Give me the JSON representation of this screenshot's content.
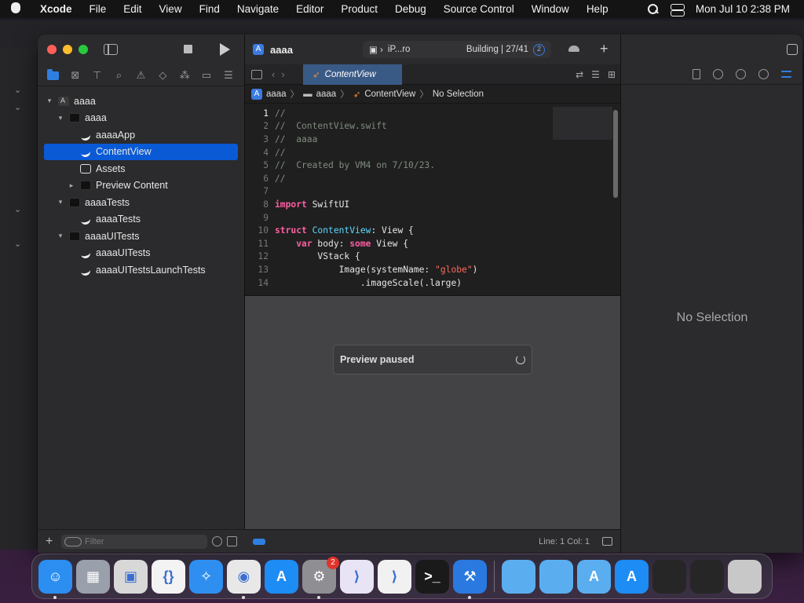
{
  "menubar": {
    "app_name": "Xcode",
    "items": [
      "File",
      "Edit",
      "View",
      "Find",
      "Navigate",
      "Editor",
      "Product",
      "Debug",
      "Source Control",
      "Window",
      "Help"
    ],
    "clock": "Mon Jul 10  2:38 PM"
  },
  "toolbar": {
    "project_name": "aaaa",
    "device": "iP...ro",
    "status": "Building | 27/41",
    "issue_count": "2"
  },
  "editor": {
    "active_tab": "ContentView",
    "breadcrumb": [
      "aaaa",
      "aaaa",
      "ContentView",
      "No Selection"
    ],
    "code_lines": [
      {
        "n": "1",
        "parts": [
          {
            "c": "cm",
            "t": "//"
          }
        ]
      },
      {
        "n": "2",
        "parts": [
          {
            "c": "cm",
            "t": "//  ContentView.swift"
          }
        ]
      },
      {
        "n": "3",
        "parts": [
          {
            "c": "cm",
            "t": "//  aaaa"
          }
        ]
      },
      {
        "n": "4",
        "parts": [
          {
            "c": "cm",
            "t": "//"
          }
        ]
      },
      {
        "n": "5",
        "parts": [
          {
            "c": "cm",
            "t": "//  Created by VM4 on 7/10/23."
          }
        ]
      },
      {
        "n": "6",
        "parts": [
          {
            "c": "cm",
            "t": "//"
          }
        ]
      },
      {
        "n": "7",
        "parts": []
      },
      {
        "n": "8",
        "parts": [
          {
            "c": "kw",
            "t": "import"
          },
          {
            "c": "pl",
            "t": " SwiftUI"
          }
        ]
      },
      {
        "n": "9",
        "parts": []
      },
      {
        "n": "10",
        "parts": [
          {
            "c": "kw",
            "t": "struct"
          },
          {
            "c": "pl",
            "t": " "
          },
          {
            "c": "ty",
            "t": "ContentView"
          },
          {
            "c": "pl",
            "t": ": View {"
          }
        ]
      },
      {
        "n": "11",
        "parts": [
          {
            "c": "pl",
            "t": "    "
          },
          {
            "c": "kw",
            "t": "var"
          },
          {
            "c": "pl",
            "t": " body: "
          },
          {
            "c": "kw",
            "t": "some"
          },
          {
            "c": "pl",
            "t": " View {"
          }
        ]
      },
      {
        "n": "12",
        "parts": [
          {
            "c": "pl",
            "t": "        VStack {"
          }
        ]
      },
      {
        "n": "13",
        "parts": [
          {
            "c": "pl",
            "t": "            Image(systemName: "
          },
          {
            "c": "st",
            "t": "\"globe\""
          },
          {
            "c": "pl",
            "t": ")"
          }
        ]
      },
      {
        "n": "14",
        "parts": [
          {
            "c": "pl",
            "t": "                .imageScale(.large)"
          }
        ]
      }
    ],
    "preview_status": "Preview paused",
    "cursor_position": "Line: 1  Col: 1"
  },
  "navigator": {
    "tree": [
      {
        "label": "aaaa",
        "depth": 0,
        "kind": "project",
        "disclosure": "▾"
      },
      {
        "label": "aaaa",
        "depth": 1,
        "kind": "folder",
        "disclosure": "▾"
      },
      {
        "label": "aaaaApp",
        "depth": 2,
        "kind": "swift",
        "disclosure": ""
      },
      {
        "label": "ContentView",
        "depth": 2,
        "kind": "swift",
        "disclosure": "",
        "selected": true
      },
      {
        "label": "Assets",
        "depth": 2,
        "kind": "assets",
        "disclosure": ""
      },
      {
        "label": "Preview Content",
        "depth": 2,
        "kind": "folder",
        "disclosure": "▸"
      },
      {
        "label": "aaaaTests",
        "depth": 1,
        "kind": "folder",
        "disclosure": "▾"
      },
      {
        "label": "aaaaTests",
        "depth": 2,
        "kind": "test",
        "disclosure": ""
      },
      {
        "label": "aaaaUITests",
        "depth": 1,
        "kind": "folder",
        "disclosure": "▾"
      },
      {
        "label": "aaaaUITests",
        "depth": 2,
        "kind": "test",
        "disclosure": ""
      },
      {
        "label": "aaaaUITestsLaunchTests",
        "depth": 2,
        "kind": "test",
        "disclosure": ""
      }
    ],
    "filter_placeholder": "Filter"
  },
  "inspector": {
    "empty_text": "No Selection"
  },
  "dock": {
    "apps": [
      {
        "name": "Finder",
        "icon": "finder-icon",
        "color": "#2b8ef0",
        "glyph": "☺",
        "running": true
      },
      {
        "name": "Launchpad",
        "icon": "launchpad-icon",
        "color": "#9aa0ab",
        "glyph": "▦",
        "running": false
      },
      {
        "name": "Network Utility",
        "icon": "network-icon",
        "color": "#d8d8d8",
        "glyph": "▣",
        "running": false
      },
      {
        "name": "Script Editor",
        "icon": "braces-icon",
        "color": "#f3f3f3",
        "glyph": "{}",
        "running": false
      },
      {
        "name": "Safari",
        "icon": "safari-icon",
        "color": "#2f8ff0",
        "glyph": "✧",
        "running": false
      },
      {
        "name": "Chrome",
        "icon": "chrome-icon",
        "color": "#e8e8e8",
        "glyph": "◉",
        "running": true
      },
      {
        "name": "App Store",
        "icon": "app-store-icon",
        "color": "#1d8cf5",
        "glyph": "A",
        "running": false
      },
      {
        "name": "System Settings",
        "icon": "settings-gear-icon",
        "color": "#8e8e93",
        "glyph": "⚙",
        "running": true,
        "badge": "2"
      },
      {
        "name": "Visual Studio",
        "icon": "visual-studio-icon",
        "color": "#e9e4f5",
        "glyph": "⟩",
        "running": false
      },
      {
        "name": "VS Code",
        "icon": "vscode-icon",
        "color": "#f1f1f1",
        "glyph": "⟩",
        "running": false
      },
      {
        "name": "Terminal",
        "icon": "terminal-icon",
        "color": "#1a1a1a",
        "glyph": ">_",
        "running": false
      },
      {
        "name": "Xcode",
        "icon": "xcode-hammer-icon",
        "color": "#2a79e0",
        "glyph": "⚒",
        "running": true
      }
    ],
    "stacks": [
      {
        "name": "Folder",
        "icon": "folder-icon",
        "color": "#5aaef0",
        "glyph": ""
      },
      {
        "name": "Documents",
        "icon": "folder-icon",
        "color": "#5aaef0",
        "glyph": ""
      },
      {
        "name": "Applications",
        "icon": "apps-folder-icon",
        "color": "#5aaef0",
        "glyph": "A"
      },
      {
        "name": "App Store Downloads",
        "icon": "app-store-icon",
        "color": "#1d8cf5",
        "glyph": "A"
      },
      {
        "name": "Screenshot 1",
        "icon": "screenshot-icon",
        "color": "#262626",
        "glyph": ""
      },
      {
        "name": "Screenshot 2",
        "icon": "screenshot-icon",
        "color": "#262626",
        "glyph": ""
      },
      {
        "name": "Trash",
        "icon": "trash-icon",
        "color": "#c8c8c8",
        "glyph": ""
      }
    ]
  }
}
